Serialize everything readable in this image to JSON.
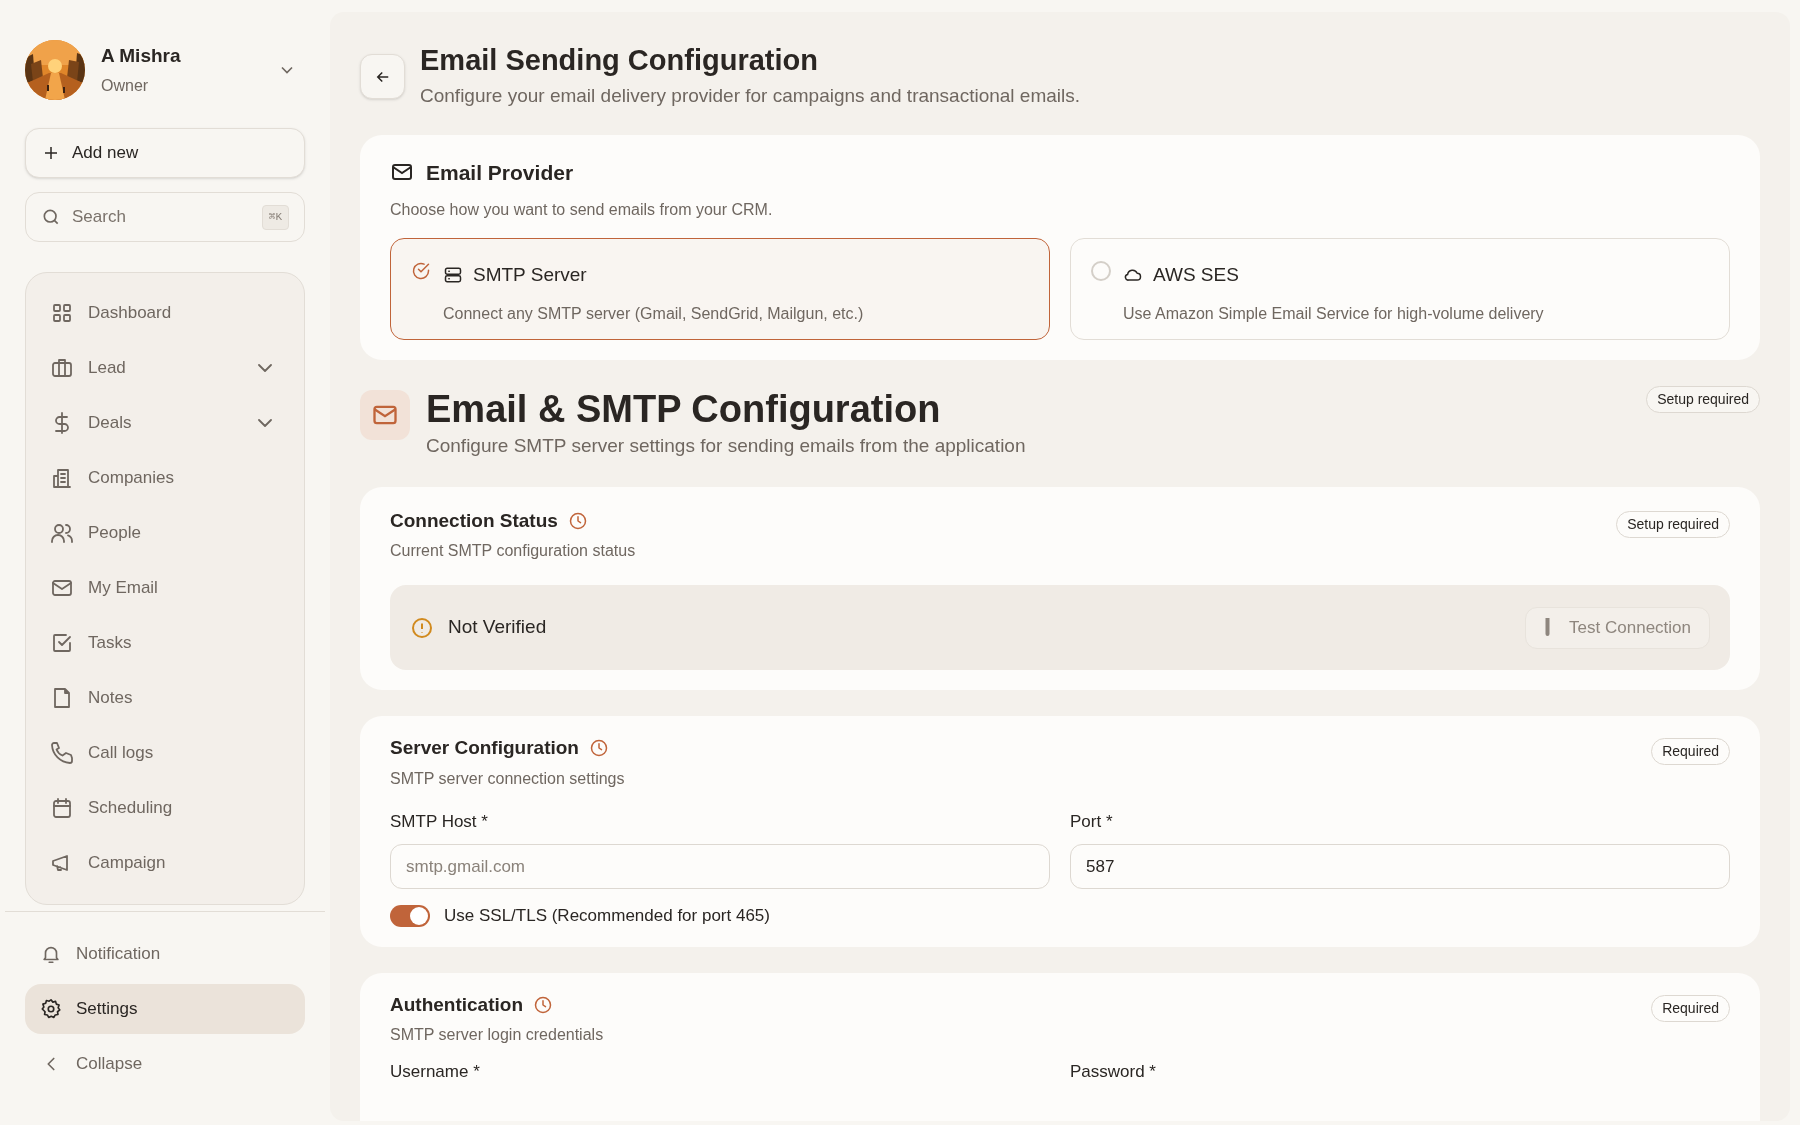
{
  "profile": {
    "name": "A Mishra",
    "role": "Owner"
  },
  "add_button": {
    "label": "Add new"
  },
  "search": {
    "placeholder": "Search",
    "shortcut": "⌘K"
  },
  "nav": [
    {
      "label": "Dashboard",
      "expandable": false,
      "selected": false
    },
    {
      "label": "Lead",
      "expandable": true,
      "selected": false
    },
    {
      "label": "Deals",
      "expandable": true,
      "selected": false
    },
    {
      "label": "Companies",
      "expandable": false,
      "selected": false
    },
    {
      "label": "People",
      "expandable": false,
      "selected": false
    },
    {
      "label": "My Email",
      "expandable": false,
      "selected": false
    },
    {
      "label": "Tasks",
      "expandable": false,
      "selected": false
    },
    {
      "label": "Notes",
      "expandable": false,
      "selected": false
    },
    {
      "label": "Call logs",
      "expandable": false,
      "selected": false
    },
    {
      "label": "Scheduling",
      "expandable": false,
      "selected": false
    },
    {
      "label": "Campaign",
      "expandable": false,
      "selected": false
    }
  ],
  "footer_nav": [
    {
      "label": "Notification",
      "selected": false
    },
    {
      "label": "Settings",
      "selected": true
    },
    {
      "label": "Collapse",
      "selected": false
    }
  ],
  "header": {
    "title": "Email Sending Configuration",
    "subtitle": "Configure your email delivery provider for campaigns and transactional emails."
  },
  "provider_card": {
    "title": "Email Provider",
    "description": "Choose how you want to send emails from your CRM.",
    "options": [
      {
        "name": "SMTP Server",
        "description": "Connect any SMTP server (Gmail, SendGrid, Mailgun, etc.)",
        "selected": true
      },
      {
        "name": "AWS SES",
        "description": "Use Amazon Simple Email Service for high-volume delivery",
        "selected": false
      }
    ]
  },
  "section": {
    "title": "Email & SMTP Configuration",
    "subtitle": "Configure SMTP server settings for sending emails from the application",
    "badge": "Setup required"
  },
  "connection": {
    "title": "Connection Status",
    "subtitle": "Current SMTP configuration status",
    "badge": "Setup required",
    "status": "Not Verified",
    "test_button": {
      "label": "Test Connection",
      "disabled": true
    }
  },
  "server": {
    "title": "Server Configuration",
    "subtitle": "SMTP server connection settings",
    "badge": "Required",
    "fields": [
      {
        "label": "SMTP Host *",
        "placeholder": "smtp.gmail.com"
      },
      {
        "label": "Port *",
        "value": "587"
      }
    ],
    "ssl": {
      "label": "Use SSL/TLS (Recommended for port 465)",
      "on": true
    }
  },
  "auth": {
    "title": "Authentication",
    "subtitle": "SMTP server login credentials",
    "badge": "Required",
    "fields": [
      {
        "label": "Username *"
      },
      {
        "label": "Password *"
      }
    ]
  }
}
